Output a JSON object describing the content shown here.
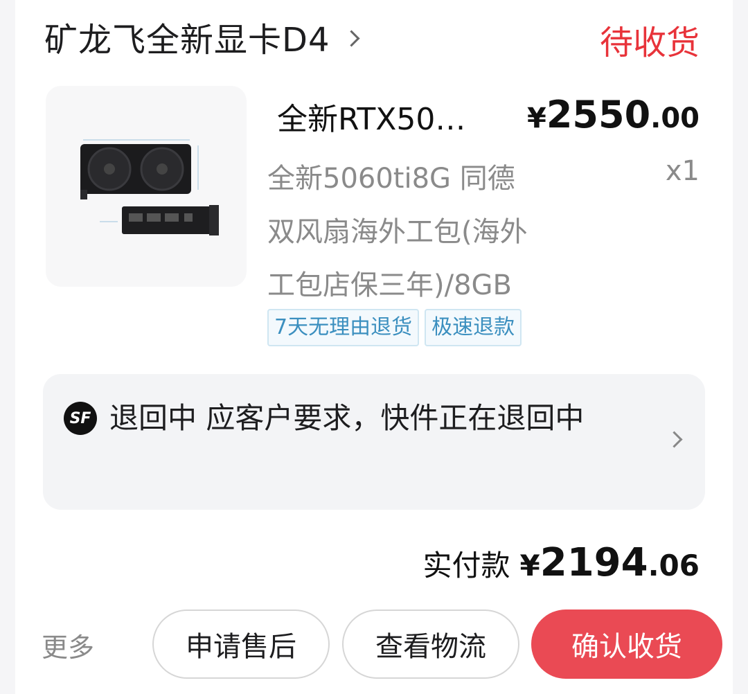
{
  "order": {
    "shop_name": "矿龙飞全新显卡D4",
    "status": "待收货"
  },
  "product": {
    "title": "全新RTX50…",
    "price_symbol": "¥",
    "price_integer": "2550",
    "price_decimal": ".00",
    "spec_lines": [
      "全新5060ti8G 同德",
      "双风扇海外工包(海外",
      "工包店保三年)/8GB"
    ],
    "quantity": "x1",
    "tags": [
      "7天无理由退货",
      "极速退款"
    ]
  },
  "logistics": {
    "carrier_icon": "SF",
    "status_text": "退回中  应客户要求，快件正在退回中"
  },
  "payment": {
    "label": "实付款",
    "symbol": "¥",
    "amount_integer": "2194",
    "amount_decimal": ".06"
  },
  "actions": {
    "more": "更多",
    "after_sales": "申请售后",
    "view_logistics": "查看物流",
    "confirm_receipt": "确认收货"
  },
  "colors": {
    "accent_red": "#e8333a",
    "button_red": "#ea4a54",
    "tag_blue": "#3b8fbf"
  }
}
